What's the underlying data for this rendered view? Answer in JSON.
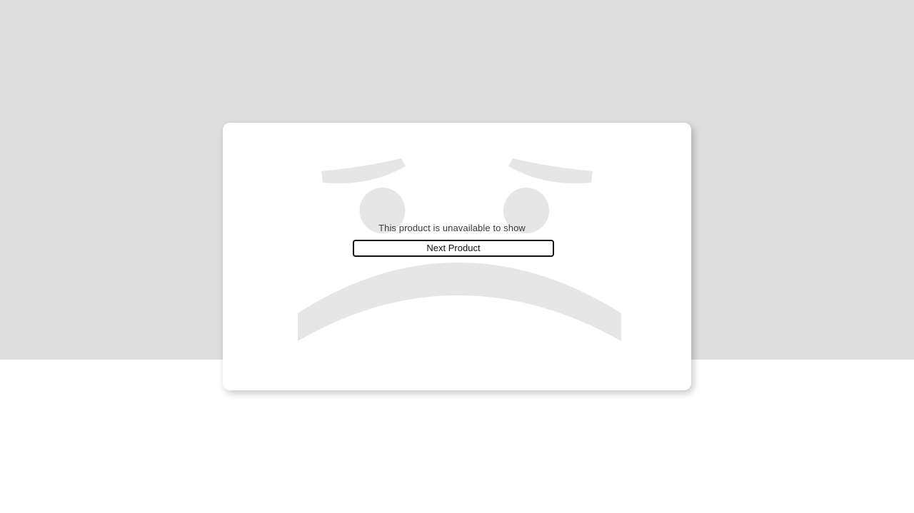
{
  "unavailable": {
    "message": "This product is unavailable to show",
    "next_button_label": "Next Product"
  },
  "colors": {
    "backdrop": "#dddddd",
    "card": "#ffffff",
    "face_graphic": "#e6e6e6",
    "button_border": "#111111",
    "text": "#3a3a3a"
  },
  "icons": {
    "illustration": "sad-face-icon"
  }
}
